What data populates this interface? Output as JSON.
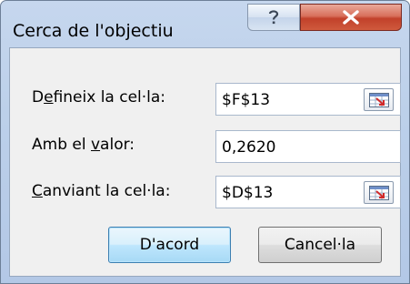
{
  "window": {
    "title": "Cerca de l'objectiu",
    "help_label": "?",
    "close_label": "X"
  },
  "form": {
    "set_cell": {
      "label_pre": "D",
      "label_mnemonic": "e",
      "label_post": "fineix la cel·la:",
      "value": "$F$13"
    },
    "to_value": {
      "label_pre": "Amb el ",
      "label_mnemonic": "v",
      "label_post": "alor:",
      "value": "0,2620"
    },
    "changing_cell": {
      "label_pre": "",
      "label_mnemonic": "C",
      "label_post": "anviant la cel·la:",
      "value": "$D$13"
    }
  },
  "buttons": {
    "ok": "D'acord",
    "cancel": "Cancel·la"
  },
  "icons": {
    "help": "question-mark-icon",
    "close": "close-x-icon",
    "range_select": "collapse-dialog-range-icon"
  }
}
